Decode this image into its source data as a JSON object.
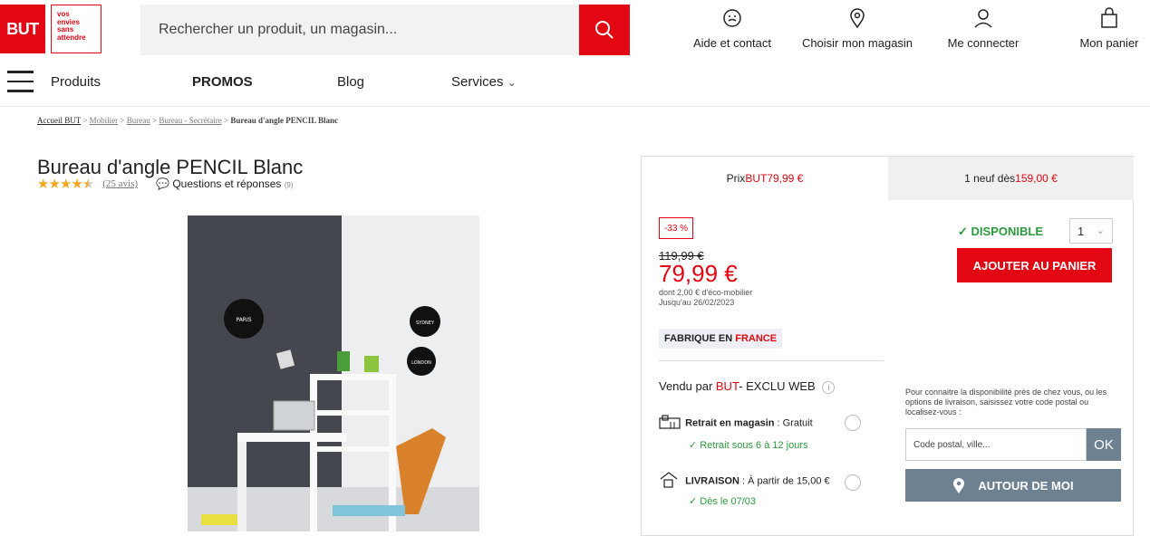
{
  "logo": {
    "brand": "BUT",
    "tagline_1": "vos",
    "tagline_2": "envies",
    "tagline_3": "sans",
    "tagline_4": "attendre"
  },
  "search": {
    "placeholder": "Rechercher un produit, un magasin..."
  },
  "header_links": {
    "help": "Aide et contact",
    "store": "Choisir mon magasin",
    "login": "Me connecter",
    "cart": "Mon panier"
  },
  "nav": {
    "products": "Produits",
    "promos": "PROMOS",
    "blog": "Blog",
    "services": "Services"
  },
  "breadcrumb": {
    "home": "Accueil BUT",
    "c1": "Mobilier",
    "c2": "Bureau",
    "c3": "Bureau - Secrétaire",
    "current": "Bureau d'angle PENCIL Blanc",
    "sep": ">"
  },
  "product": {
    "title": "Bureau d'angle PENCIL Blanc",
    "rating_stars": 4.5,
    "reviews": "(25 avis)",
    "qa_label": "Questions et réponses",
    "qa_count": "(9)"
  },
  "tabs": {
    "a_prefix": "Prix ",
    "a_brand": "BUT",
    "a_price": " 79,99 €",
    "b_prefix": "1 neuf dès ",
    "b_price": "159,00 €"
  },
  "price": {
    "discount": "-33 %",
    "old": "119,99 €",
    "current": "79,99 €",
    "eco": "dont 2,00 € d'éco-mobilier",
    "until": "Jusqu'au 26/02/2023",
    "fab_prefix": "FABRIQUE EN ",
    "fab_country": "FRANCE"
  },
  "availability": {
    "status": "DISPONIBLE",
    "qty": "1",
    "add_to_cart": "AJOUTER AU PANIER"
  },
  "seller": {
    "prefix": "Vendu par ",
    "brand": "BUT",
    "suffix": "- EXCLU WEB"
  },
  "delivery": {
    "pickup_label": "Retrait en magasin",
    "pickup_value": " : Gratuit",
    "pickup_delay": "Retrait sous 6 à 12 jours",
    "ship_label": "LIVRAISON",
    "ship_value": " : À partir de 15,00 €",
    "ship_date": "Dès le 07/03"
  },
  "locator": {
    "help": "Pour connaitre la disponibilité près de chez vous, ou les options de livraison, saisissez votre code postal ou localisez-vous :",
    "placeholder": "Code postal, ville...",
    "ok": "OK",
    "around": "AUTOUR DE MOI"
  },
  "photo_labels": {
    "paris": "PARIS",
    "sydney": "SYDNEY",
    "london": "LONDON"
  },
  "colors": {
    "brand_red": "#e30613",
    "green": "#2b9a3d",
    "slate": "#6e8191",
    "star": "#f5a623"
  }
}
